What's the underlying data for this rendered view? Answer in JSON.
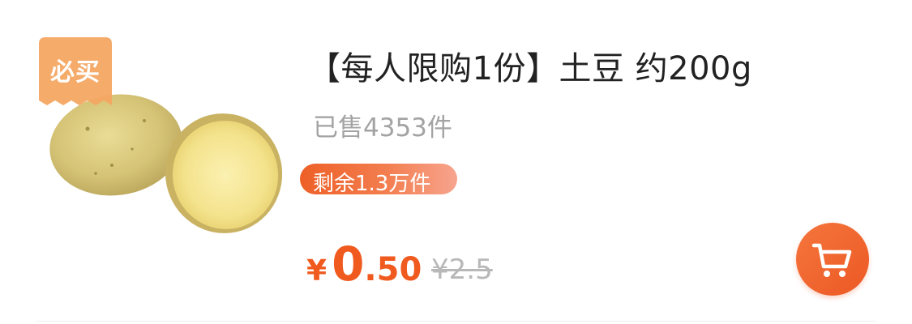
{
  "product": {
    "badge": "必买",
    "title": "【每人限购1份】土豆 约200g",
    "sold": "已售4353件",
    "stock_tag": "剩余1.3万件",
    "price": {
      "currency": "¥",
      "integer": "0",
      "decimal": ".50",
      "original": "¥2.5"
    },
    "image_icon": "potato-image",
    "cart_icon": "shopping-cart-icon"
  },
  "colors": {
    "accent": "#F05A1E",
    "badge": "#F4A762",
    "title": "#222222",
    "muted": "#A3A3A3"
  }
}
